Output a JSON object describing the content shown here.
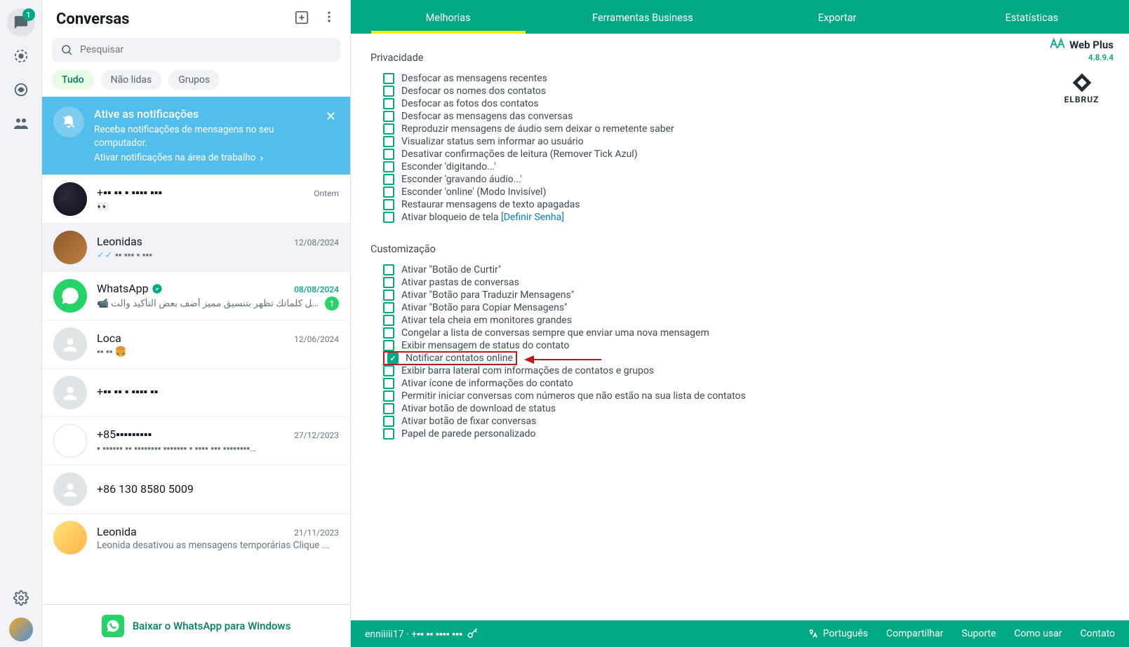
{
  "farLeft": {
    "badge": "1"
  },
  "leftPanel": {
    "title": "Conversas",
    "search_placeholder": "Pesquisar",
    "filters": {
      "all": "Tudo",
      "unread": "Não lidas",
      "groups": "Grupos"
    },
    "notif": {
      "title": "Ative as notificações",
      "line1": "Receba notificações de mensagens no seu computador.",
      "link": "Ativar notificações na área de trabalho"
    },
    "chats": [
      {
        "name": "+▪▪ ▪▪ ▪ ▪▪▪▪ ▪▪▪",
        "time": "Ontem",
        "preview": "👀",
        "avatar": "av1"
      },
      {
        "name": "Leonidas",
        "time": "12/08/2024",
        "preview": "✓✓ ▪▪ ▪▪▪ ▪ ▪▪▪",
        "avatar": "av2",
        "ticks": true,
        "selected": true
      },
      {
        "name": "WhatsApp",
        "time": "08/08/2024",
        "preview": "📹 ‎اجعل كلماتك تظهر بتنسيق مميز أضف بعض التأكيد والت...",
        "avatar": "wa",
        "verified": true,
        "unread": "1",
        "time_green": true
      },
      {
        "name": "Loca",
        "time": "12/06/2024",
        "preview": "▪▪ ▪▪  🍔",
        "avatar": "default"
      },
      {
        "name": "+▪▪ ▪▪ ▪ ▪▪▪▪ ▪▪",
        "time": "",
        "preview": "",
        "avatar": "default"
      },
      {
        "name": "+85▪▪▪▪▪▪▪▪▪",
        "time": "27/12/2023",
        "preview": "▪ ▪▪▪▪▪▪ ▪▪ ▪▪▪▪▪▪▪▪ ▪▪▪▪▪▪▪ ▪ ▪▪▪▪ ▪▪▪ ▪▪▪▪▪▪▪▪…",
        "avatar": "av4"
      },
      {
        "name": "+86 130 8580 5009",
        "time": "",
        "preview": "",
        "avatar": "default"
      },
      {
        "name": "Leonida",
        "time": "21/11/2023",
        "preview": "Leonida desativou as mensagens temporárias Clique ...",
        "avatar": "av5"
      }
    ],
    "download": "Baixar o WhatsApp para Windows"
  },
  "tabs": {
    "t1": "Melhorias",
    "t2": "Ferramentas Business",
    "t3": "Exportar",
    "t4": "Estatísticas"
  },
  "brand": {
    "name": "Web Plus",
    "version": "4.8.9.4",
    "elbruz": "ELBRUZ"
  },
  "sections": {
    "privacy_title": "Privacidade",
    "privacy": [
      "Desfocar as mensagens recentes",
      "Desfocar os nomes dos contatos",
      "Desfocar as fotos dos contatos",
      "Desfocar as mensagens das conversas",
      "Reproduzir mensagens de áudio sem deixar o remetente saber",
      "Visualizar status sem informar ao usuário",
      "Desativar confirmações de leitura (Remover Tick Azul)",
      "Esconder 'digitando...'",
      "Esconder 'gravando áudio...'",
      "Esconder 'online' (Modo Invisível)",
      "Restaurar mensagens de texto apagadas"
    ],
    "privacy_last_prefix": "Ativar bloqueio de tela ",
    "privacy_last_link": "[Definir Senha]",
    "custom_title": "Customização",
    "custom": [
      "Ativar \"Botão de Curtir\"",
      "Ativar pastas de conversas",
      "Ativar \"Botão para Traduzir Mensagens\"",
      "Ativar \"Botão para Copiar Mensagens\"",
      "Ativar tela cheia em monitores grandes",
      "Congelar a lista de conversas sempre que enviar uma nova mensagem",
      "Exibir mensagem de status do contato",
      "Notificar contatos online",
      "Exibir barra lateral com informações de contatos e grupos",
      "Ativar ícone de informações do contato",
      "Permitir iniciar conversas com números que não estão na sua lista de contatos",
      "Ativar botão de download de status",
      "Ativar botão de fixar conversas",
      "Papel de parede personalizado"
    ],
    "custom_checked_index": 7,
    "custom_highlight_index": 7
  },
  "bottomBar": {
    "user": "enniiiii17 · +▪▪ ▪▪ ▪▪▪▪ ▪▪▪",
    "lang": "Português",
    "share": "Compartilhar",
    "support": "Suporte",
    "howto": "Como usar",
    "contact": "Contato"
  }
}
